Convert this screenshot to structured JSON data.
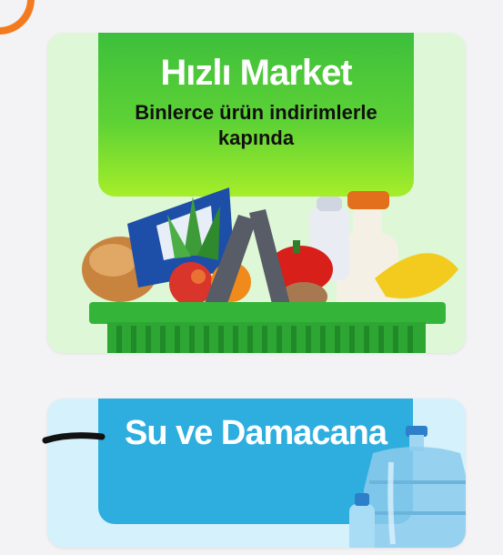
{
  "market": {
    "title": "Hızlı Market",
    "subtitle": "Binlerce ürün indirimlerle kapında",
    "image": "grocery-basket-illustration"
  },
  "water": {
    "title": "Su ve Damacana",
    "image": "water-jug-illustration"
  },
  "colors": {
    "accent_orange": "#f47a20",
    "market_green": "#4cc93a",
    "market_card_bg": "#def7d7",
    "water_blue": "#2eaede",
    "water_card_bg": "#d5f1fb"
  }
}
